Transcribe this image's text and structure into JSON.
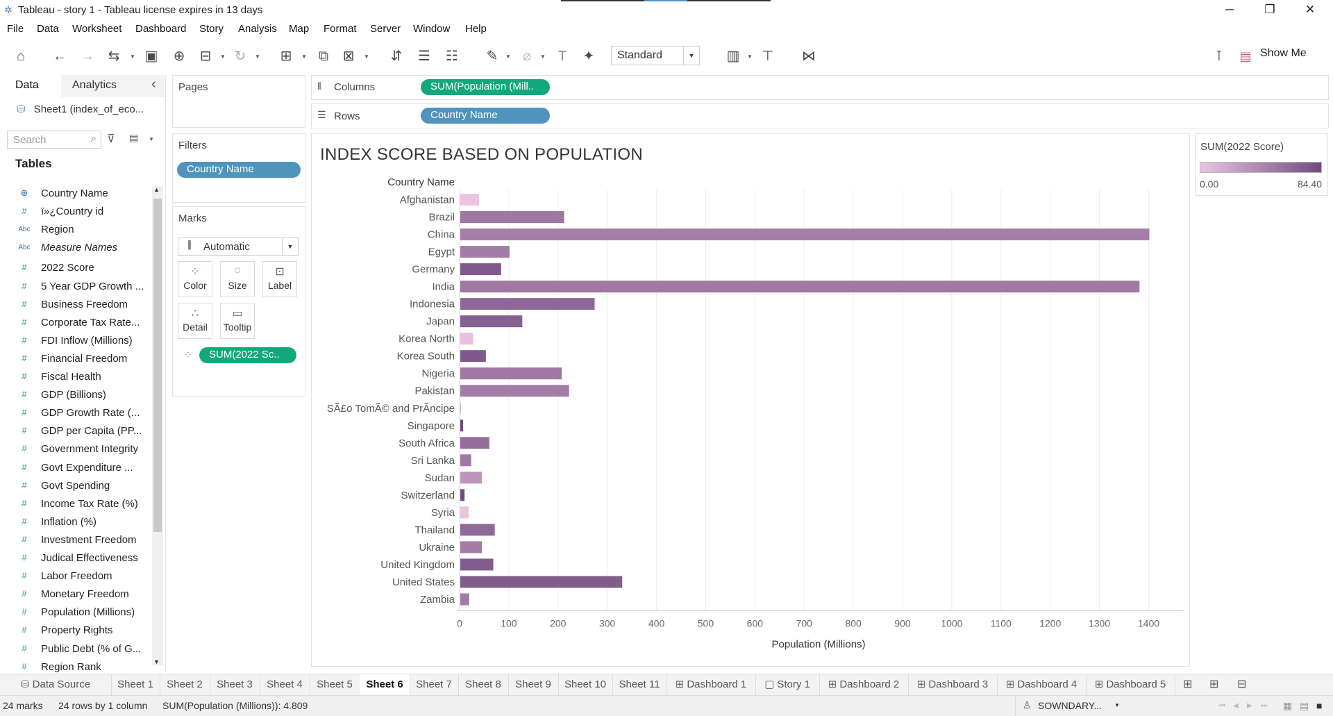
{
  "window": {
    "title": "Tableau - story 1 - Tableau license expires in 13 days",
    "minimize": "─",
    "restore": "❐",
    "close": "✕"
  },
  "menu": [
    "File",
    "Data",
    "Worksheet",
    "Dashboard",
    "Story",
    "Analysis",
    "Map",
    "Format",
    "Server",
    "Window",
    "Help"
  ],
  "toolbar": {
    "fit_select": "Standard",
    "show_me": "Show Me"
  },
  "left_panel": {
    "tab_data": "Data",
    "tab_analytics": "Analytics",
    "collapse_glyph": "‹",
    "data_source": "Sheet1 (index_of_eco...",
    "search_placeholder": "Search",
    "tables_heading": "Tables",
    "fields": [
      {
        "name": "Country Name",
        "type": "geo",
        "italic": false
      },
      {
        "name": "ï»¿Country id",
        "type": "num",
        "italic": false
      },
      {
        "name": "Region",
        "type": "abc",
        "italic": false
      },
      {
        "name": "Measure Names",
        "type": "abc",
        "italic": true
      },
      {
        "name": "2022 Score",
        "type": "num",
        "italic": false
      },
      {
        "name": "5 Year GDP Growth ...",
        "type": "num",
        "italic": false
      },
      {
        "name": "Business Freedom",
        "type": "num",
        "italic": false
      },
      {
        "name": "Corporate Tax Rate...",
        "type": "num",
        "italic": false
      },
      {
        "name": "FDI Inflow (Millions)",
        "type": "num",
        "italic": false
      },
      {
        "name": "Financial Freedom",
        "type": "num",
        "italic": false
      },
      {
        "name": "Fiscal Health",
        "type": "num",
        "italic": false
      },
      {
        "name": "GDP (Billions)",
        "type": "num",
        "italic": false
      },
      {
        "name": "GDP Growth Rate (...",
        "type": "num",
        "italic": false
      },
      {
        "name": "GDP per Capita (PP...",
        "type": "num",
        "italic": false
      },
      {
        "name": "Government Integrity",
        "type": "num",
        "italic": false
      },
      {
        "name": "Govt Expenditure ...",
        "type": "num",
        "italic": false
      },
      {
        "name": "Govt Spending",
        "type": "num",
        "italic": false
      },
      {
        "name": "Income Tax Rate (%)",
        "type": "num",
        "italic": false
      },
      {
        "name": "Inflation (%)",
        "type": "num",
        "italic": false
      },
      {
        "name": "Investment Freedom",
        "type": "num",
        "italic": false
      },
      {
        "name": "Judical Effectiveness",
        "type": "num",
        "italic": false
      },
      {
        "name": "Labor Freedom",
        "type": "num",
        "italic": false
      },
      {
        "name": "Monetary Freedom",
        "type": "num",
        "italic": false
      },
      {
        "name": "Population (Millions)",
        "type": "num",
        "italic": false
      },
      {
        "name": "Property Rights",
        "type": "num",
        "italic": false
      },
      {
        "name": "Public Debt (% of G...",
        "type": "num",
        "italic": false
      },
      {
        "name": "Region Rank",
        "type": "num",
        "italic": false
      }
    ]
  },
  "shelves": {
    "pages_title": "Pages",
    "filters_title": "Filters",
    "filter_pill": "Country Name",
    "marks_title": "Marks",
    "mark_type": "Automatic",
    "mark_buttons": [
      "Color",
      "Size",
      "Label",
      "Detail",
      "Tooltip"
    ],
    "color_pill": "SUM(2022 Sc..",
    "columns_label": "Columns",
    "columns_pill": "SUM(Population (Mill..",
    "rows_label": "Rows",
    "rows_pill": "Country Name"
  },
  "legend": {
    "title": "SUM(2022 Score)",
    "min_label": "0.00",
    "max_label": "84.40",
    "color_low": "#ecc3e0",
    "color_high": "#6f4a7e"
  },
  "chart_data": {
    "type": "bar",
    "orientation": "horizontal",
    "title": "INDEX SCORE BASED ON POPULATION",
    "row_header": "Country Name",
    "xlabel": "Population (Millions)",
    "xlim": [
      0,
      1460
    ],
    "xticks": [
      0,
      100,
      200,
      300,
      400,
      500,
      600,
      700,
      800,
      900,
      1000,
      1100,
      1200,
      1300,
      1400
    ],
    "grid": true,
    "color_scale_max": 84.4,
    "categories": [
      "Afghanistan",
      "Brazil",
      "China",
      "Egypt",
      "Germany",
      "India",
      "Indonesia",
      "Japan",
      "Korea North",
      "Korea South",
      "Nigeria",
      "Pakistan",
      "SÃ£o TomÃ© and PrÃncipe",
      "Singapore",
      "South Africa",
      "Sri Lanka",
      "Sudan",
      "Switzerland",
      "Syria",
      "Thailand",
      "Ukraine",
      "United Kingdom",
      "United States",
      "Zambia"
    ],
    "values": [
      38,
      211,
      1400,
      100,
      83,
      1380,
      273,
      126,
      26,
      52,
      206,
      221,
      0.2,
      5.7,
      59,
      22,
      44,
      8.6,
      17,
      70,
      44,
      67,
      329,
      18
    ],
    "color_values": [
      0,
      53,
      48,
      49,
      73,
      52,
      64,
      69,
      3,
      74,
      52,
      49,
      55,
      84.4,
      59,
      52,
      32,
      84,
      0,
      63,
      49,
      72,
      72,
      50
    ]
  },
  "sheet_tabs": {
    "data_source": "Data Source",
    "tabs": [
      "Sheet 1",
      "Sheet 2",
      "Sheet 3",
      "Sheet 4",
      "Sheet 5",
      "Sheet 6",
      "Sheet 7",
      "Sheet 8",
      "Sheet 9",
      "Sheet 10",
      "Sheet 11",
      "Dashboard 1",
      "Story 1",
      "Dashboard 2",
      "Dashboard 3",
      "Dashboard 4",
      "Dashboard 5"
    ],
    "active": "Sheet 6"
  },
  "status": {
    "marks": "24 marks",
    "rows": "24 rows by 1 column",
    "sum": "SUM(Population (Millions)): 4.809",
    "user": "SOWNDARY..."
  }
}
